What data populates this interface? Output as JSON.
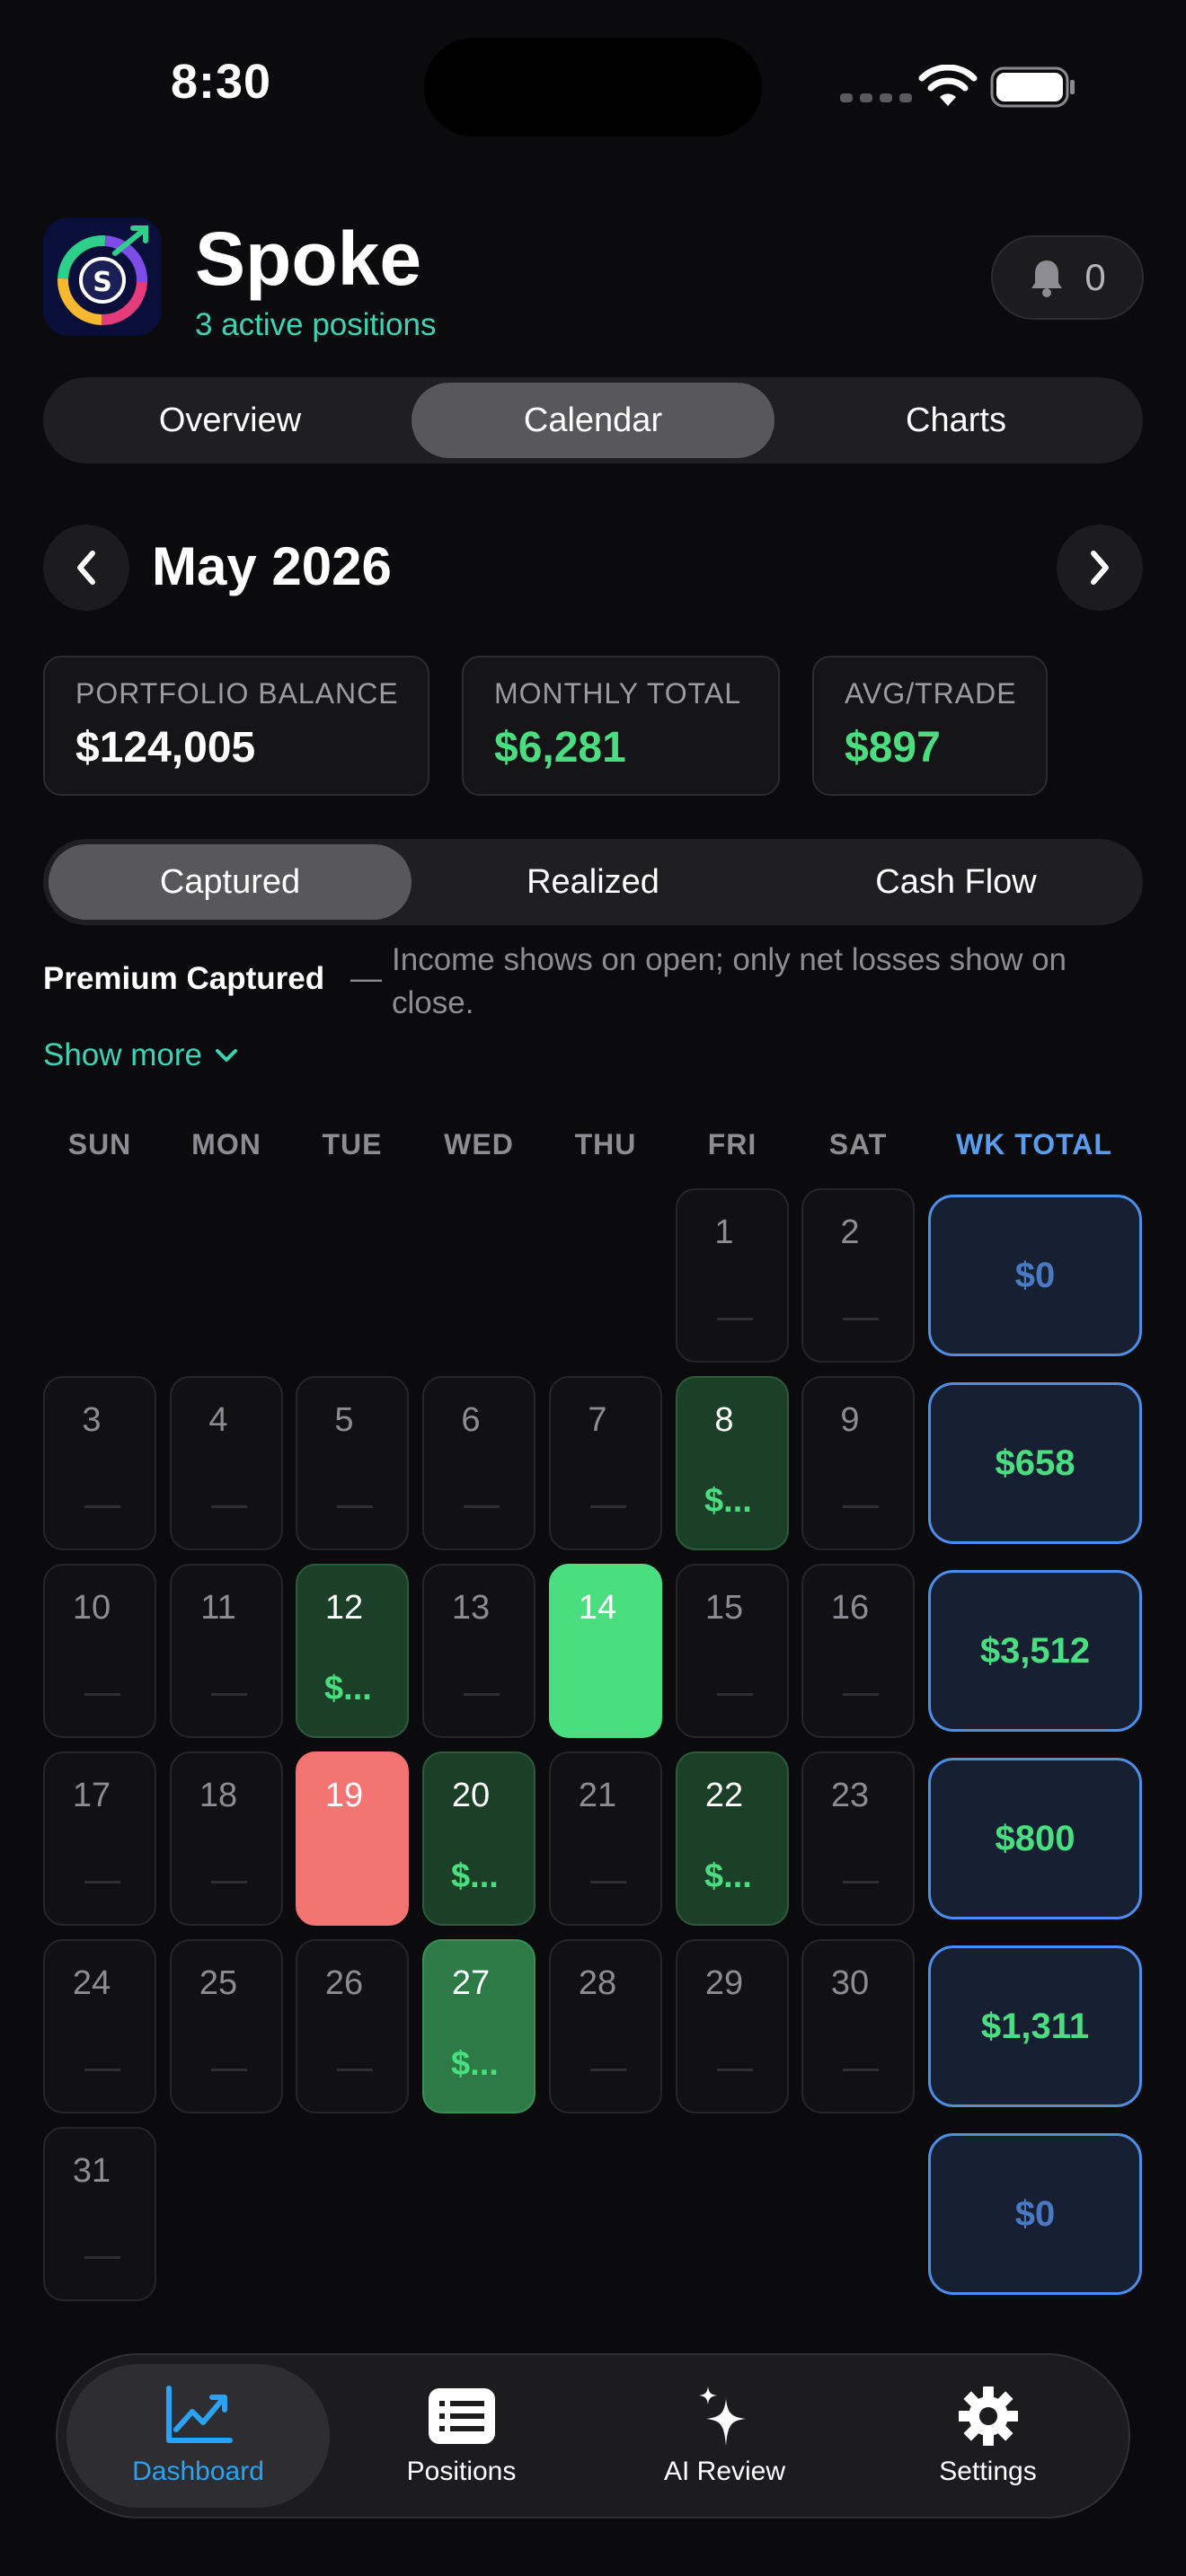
{
  "status_bar": {
    "time": "8:30"
  },
  "header": {
    "title": "Spoke",
    "subtitle": "3 active positions",
    "notification_count": "0"
  },
  "main_tabs": [
    {
      "label": "Overview"
    },
    {
      "label": "Calendar",
      "active": true
    },
    {
      "label": "Charts"
    }
  ],
  "month": {
    "title": "May 2026"
  },
  "stats": [
    {
      "label": "PORTFOLIO BALANCE",
      "value": "$124,005"
    },
    {
      "label": "MONTHLY TOTAL",
      "value": "$6,281"
    },
    {
      "label": "AVG/TRADE",
      "value": "$897"
    }
  ],
  "mode_tabs": [
    {
      "label": "Captured",
      "active": true
    },
    {
      "label": "Realized"
    },
    {
      "label": "Cash Flow"
    }
  ],
  "description": {
    "title": "Premium Captured",
    "dash": "—",
    "text": "Income shows on open; only net losses show on close.",
    "show_more": "Show more"
  },
  "calendar": {
    "weekdays": [
      "SUN",
      "MON",
      "TUE",
      "WED",
      "THU",
      "FRI",
      "SAT"
    ],
    "week_total_header": "WK TOTAL",
    "days": [
      {
        "n": "1",
        "amt": ""
      },
      {
        "n": "2",
        "amt": ""
      },
      {
        "n": "3",
        "amt": ""
      },
      {
        "n": "4",
        "amt": ""
      },
      {
        "n": "5",
        "amt": ""
      },
      {
        "n": "6",
        "amt": ""
      },
      {
        "n": "7",
        "amt": ""
      },
      {
        "n": "8",
        "amt": "$..."
      },
      {
        "n": "9",
        "amt": ""
      },
      {
        "n": "10",
        "amt": ""
      },
      {
        "n": "11",
        "amt": ""
      },
      {
        "n": "12",
        "amt": "$..."
      },
      {
        "n": "13",
        "amt": ""
      },
      {
        "n": "14",
        "amt": ""
      },
      {
        "n": "15",
        "amt": ""
      },
      {
        "n": "16",
        "amt": ""
      },
      {
        "n": "17",
        "amt": ""
      },
      {
        "n": "18",
        "amt": ""
      },
      {
        "n": "19",
        "amt": ""
      },
      {
        "n": "20",
        "amt": "$..."
      },
      {
        "n": "21",
        "amt": ""
      },
      {
        "n": "22",
        "amt": "$..."
      },
      {
        "n": "23",
        "amt": ""
      },
      {
        "n": "24",
        "amt": ""
      },
      {
        "n": "25",
        "amt": ""
      },
      {
        "n": "26",
        "amt": ""
      },
      {
        "n": "27",
        "amt": "$..."
      },
      {
        "n": "28",
        "amt": ""
      },
      {
        "n": "29",
        "amt": ""
      },
      {
        "n": "30",
        "amt": ""
      },
      {
        "n": "31",
        "amt": ""
      }
    ],
    "week_totals": [
      "$0",
      "$658",
      "$3,512",
      "$800",
      "$1,311",
      "$0"
    ]
  },
  "tabbar": [
    {
      "label": "Dashboard",
      "active": true
    },
    {
      "label": "Positions"
    },
    {
      "label": "AI Review"
    },
    {
      "label": "Settings"
    }
  ]
}
